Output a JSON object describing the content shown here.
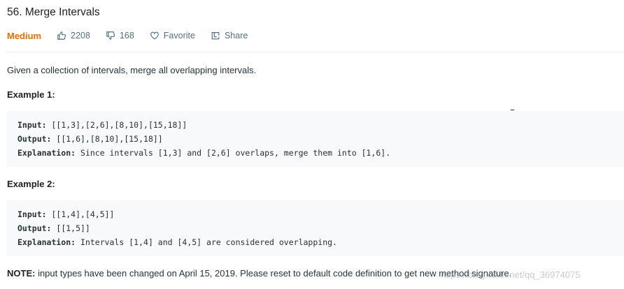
{
  "problem": {
    "title": "56. Merge Intervals",
    "difficulty": "Medium",
    "likes": "2208",
    "dislikes": "168",
    "favorite_label": "Favorite",
    "share_label": "Share",
    "description": "Given a collection of intervals, merge all overlapping intervals."
  },
  "colors": {
    "difficulty_medium": "#ef6c00",
    "code_background": "#f7f9fa",
    "meta_text": "#546e7a"
  },
  "examples": [
    {
      "title": "Example 1:",
      "input_label": "Input:",
      "input": " [[1,3],[2,6],[8,10],[15,18]]",
      "output_label": "Output:",
      "output": " [[1,6],[8,10],[15,18]]",
      "explanation_label": "Explanation:",
      "explanation": " Since intervals [1,3] and [2,6] overlaps, merge them into [1,6]."
    },
    {
      "title": "Example 2:",
      "input_label": "Input:",
      "input": " [[1,4],[4,5]]",
      "output_label": "Output:",
      "output": " [[1,5]]",
      "explanation_label": "Explanation:",
      "explanation": " Intervals [1,4] and [4,5] are considered overlapping."
    }
  ],
  "note": {
    "label": "NOTE:",
    "text": " input types have been changed on April 15, 2019. Please reset to default code definition to get new method signature."
  },
  "watermark": "https://blog.csdn.net/qq_36974075"
}
